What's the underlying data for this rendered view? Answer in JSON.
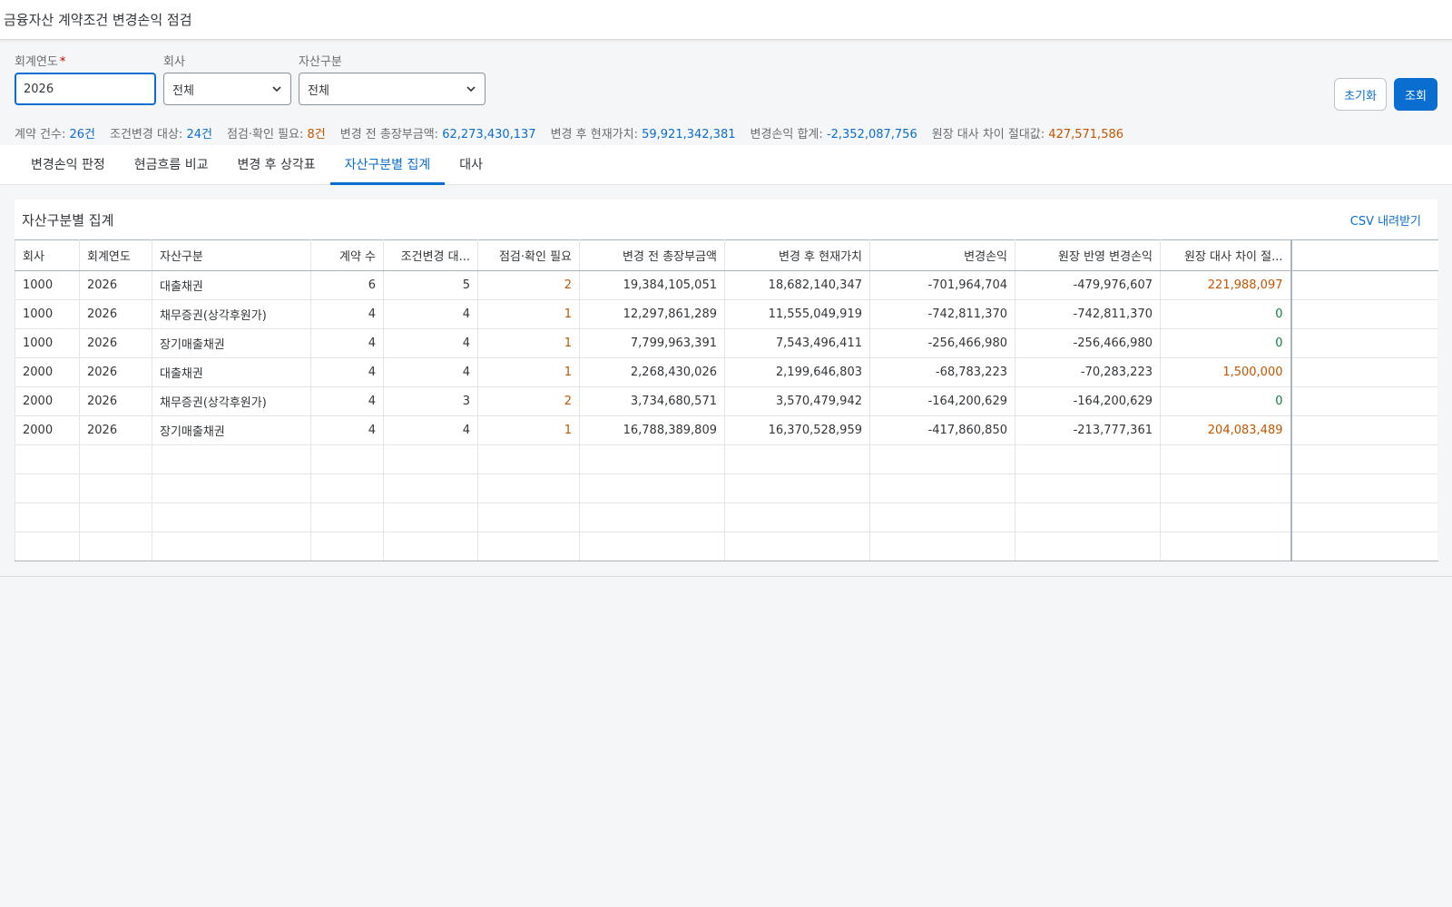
{
  "title": "금융자산 계약조건 변경손익 점검",
  "filters": {
    "year": {
      "label": "회계연도",
      "required_mark": "*",
      "value": "2026"
    },
    "company": {
      "label": "회사",
      "value": "전체"
    },
    "asset_type": {
      "label": "자산구분",
      "value": "전체"
    }
  },
  "buttons": {
    "reset": "초기화",
    "search": "조회"
  },
  "summary": {
    "contract_count": {
      "label": "계약 건수:",
      "value": "26건"
    },
    "changed_target": {
      "label": "조건변경 대상:",
      "value": "24건"
    },
    "need_check": {
      "label": "점검·확인 필요:",
      "value": "8건"
    },
    "before_total": {
      "label": "변경 전 총장부금액:",
      "value": "62,273,430,137"
    },
    "after_pv": {
      "label": "변경 후 현재가치:",
      "value": "59,921,342,381"
    },
    "pl_total": {
      "label": "변경손익 합계:",
      "value": "-2,352,087,756"
    },
    "ledger_diff": {
      "label": "원장 대사 차이 절대값:",
      "value": "427,571,586"
    }
  },
  "tabs": [
    {
      "label": "변경손익 판정",
      "active": false
    },
    {
      "label": "현금흐름 비교",
      "active": false
    },
    {
      "label": "변경 후 상각표",
      "active": false
    },
    {
      "label": "자산구분별 집계",
      "active": true
    },
    {
      "label": "대사",
      "active": false
    }
  ],
  "panel": {
    "title": "자산구분별 집계",
    "csv_label": "CSV 내려받기"
  },
  "table": {
    "columns": [
      "회사",
      "회계연도",
      "자산구분",
      "계약 수",
      "조건변경 대...",
      "점검·확인 필요",
      "변경 전 총장부금액",
      "변경 후 현재가치",
      "변경손익",
      "원장 반영 변경손익",
      "원장 대사 차이 절..."
    ],
    "rows": [
      [
        "1000",
        "2026",
        "대출채권",
        "6",
        "5",
        "2",
        "19,384,105,051",
        "18,682,140,347",
        "-701,964,704",
        "-479,976,607",
        "221,988,097"
      ],
      [
        "1000",
        "2026",
        "채무증권(상각후원가)",
        "4",
        "4",
        "1",
        "12,297,861,289",
        "11,555,049,919",
        "-742,811,370",
        "-742,811,370",
        "0"
      ],
      [
        "1000",
        "2026",
        "장기매출채권",
        "4",
        "4",
        "1",
        "7,799,963,391",
        "7,543,496,411",
        "-256,466,980",
        "-256,466,980",
        "0"
      ],
      [
        "2000",
        "2026",
        "대출채권",
        "4",
        "4",
        "1",
        "2,268,430,026",
        "2,199,646,803",
        "-68,783,223",
        "-70,283,223",
        "1,500,000"
      ],
      [
        "2000",
        "2026",
        "채무증권(상각후원가)",
        "4",
        "3",
        "2",
        "3,734,680,571",
        "3,570,479,942",
        "-164,200,629",
        "-164,200,629",
        "0"
      ],
      [
        "2000",
        "2026",
        "장기매출채권",
        "4",
        "4",
        "1",
        "16,788,389,809",
        "16,370,528,959",
        "-417,860,850",
        "-213,777,361",
        "204,083,489"
      ]
    ],
    "empty_rows": 4
  },
  "colors": {
    "accent": "#0a6ed1",
    "warning": "#c35500",
    "positive": "#107e3e"
  }
}
